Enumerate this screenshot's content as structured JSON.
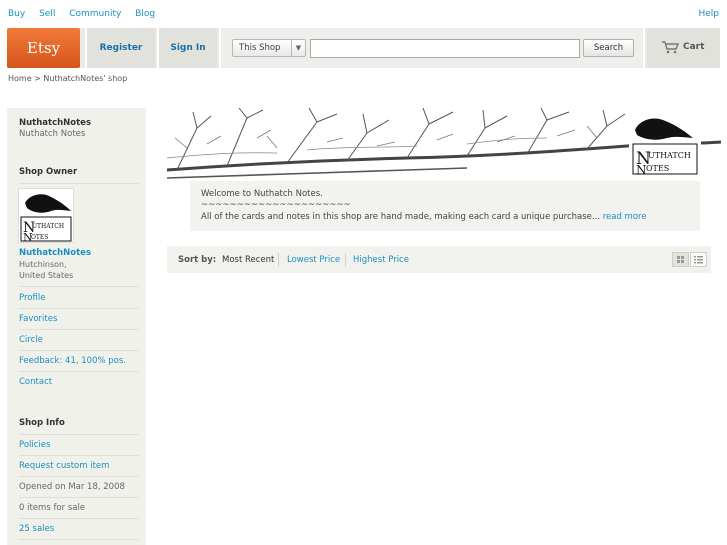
{
  "topnav": {
    "items": [
      "Buy",
      "Sell",
      "Community",
      "Blog"
    ],
    "help": "Help"
  },
  "header": {
    "logo": "Etsy",
    "register": "Register",
    "signin": "Sign In",
    "scope": "This Shop",
    "search_value": "",
    "search_button": "Search",
    "cart": "Cart"
  },
  "breadcrumb": "Home > NuthatchNotes' shop",
  "sidebar": {
    "shop_username": "NuthatchNotes",
    "shop_name": "Nuthatch Notes",
    "owner_title": "Shop Owner",
    "owner_name": "NuthatchNotes",
    "location_city": "Hutchinson,",
    "location_country": "United States",
    "owner_links": [
      "Profile",
      "Favorites",
      "Circle",
      "Feedback: 41, 100% pos.",
      "Contact"
    ],
    "info_title": "Shop Info",
    "policies": "Policies",
    "request_custom": "Request custom item",
    "opened": "Opened on Mar 18, 2008",
    "items_for_sale": "0 items for sale",
    "sales": "25 sales"
  },
  "logo_image": {
    "word1": "UTHATCH",
    "letter1": "N",
    "word2": "OTES",
    "letter2": "N"
  },
  "welcome": {
    "line1": "Welcome to Nuthatch Notes.",
    "line2": "~~~~~~~~~~~~~~~~~~~~~",
    "line3": "All of the cards and notes in this shop are hand made, making each card a unique purchase...",
    "read_more": "read more"
  },
  "sort": {
    "label": "Sort by:",
    "options": [
      "Most Recent",
      "Lowest Price",
      "Highest Price"
    ]
  },
  "colors": {
    "brand": "#e8662b",
    "link": "#1a8fbe"
  }
}
